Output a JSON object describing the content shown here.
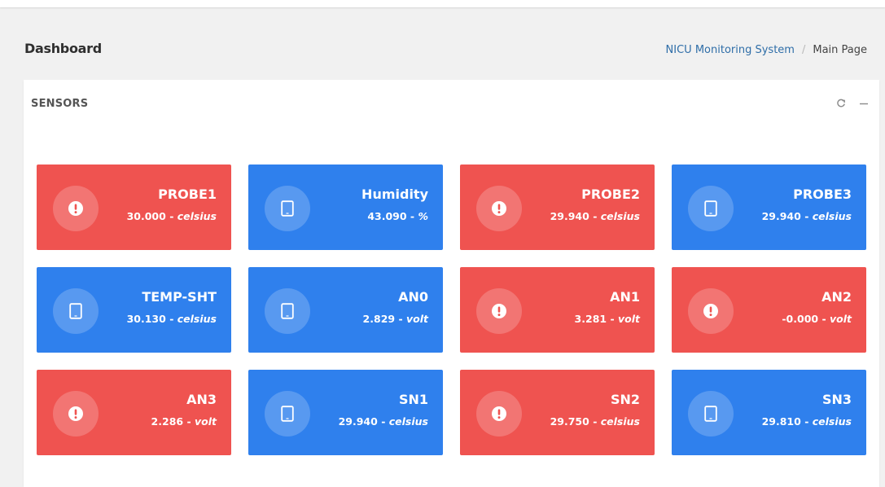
{
  "header": {
    "title": "Dashboard",
    "breadcrumb": {
      "link": "NICU Monitoring System",
      "separator": "/",
      "current": "Main Page"
    }
  },
  "panel": {
    "title": "SENSORS",
    "tools": [
      "refresh-icon",
      "minimize-icon"
    ]
  },
  "colors": {
    "alert": "#ef5350",
    "ok": "#2f80ed",
    "link": "#2f6ea8"
  },
  "sensors": [
    {
      "name": "PROBE1",
      "value": "30.000",
      "unit": "celsius",
      "status": "alert",
      "icon": "exclamation-icon"
    },
    {
      "name": "Humidity",
      "value": "43.090",
      "unit": "%",
      "status": "ok",
      "icon": "tablet-icon"
    },
    {
      "name": "PROBE2",
      "value": "29.940",
      "unit": "celsius",
      "status": "alert",
      "icon": "exclamation-icon"
    },
    {
      "name": "PROBE3",
      "value": "29.940",
      "unit": "celsius",
      "status": "ok",
      "icon": "tablet-icon"
    },
    {
      "name": "TEMP-SHT",
      "value": "30.130",
      "unit": "celsius",
      "status": "ok",
      "icon": "tablet-icon"
    },
    {
      "name": "AN0",
      "value": "2.829",
      "unit": "volt",
      "status": "ok",
      "icon": "tablet-icon"
    },
    {
      "name": "AN1",
      "value": "3.281",
      "unit": "volt",
      "status": "alert",
      "icon": "exclamation-icon"
    },
    {
      "name": "AN2",
      "value": "-0.000",
      "unit": "volt",
      "status": "alert",
      "icon": "exclamation-icon"
    },
    {
      "name": "AN3",
      "value": "2.286",
      "unit": "volt",
      "status": "alert",
      "icon": "exclamation-icon"
    },
    {
      "name": "SN1",
      "value": "29.940",
      "unit": "celsius",
      "status": "ok",
      "icon": "tablet-icon"
    },
    {
      "name": "SN2",
      "value": "29.750",
      "unit": "celsius",
      "status": "alert",
      "icon": "exclamation-icon"
    },
    {
      "name": "SN3",
      "value": "29.810",
      "unit": "celsius",
      "status": "ok",
      "icon": "tablet-icon"
    }
  ]
}
